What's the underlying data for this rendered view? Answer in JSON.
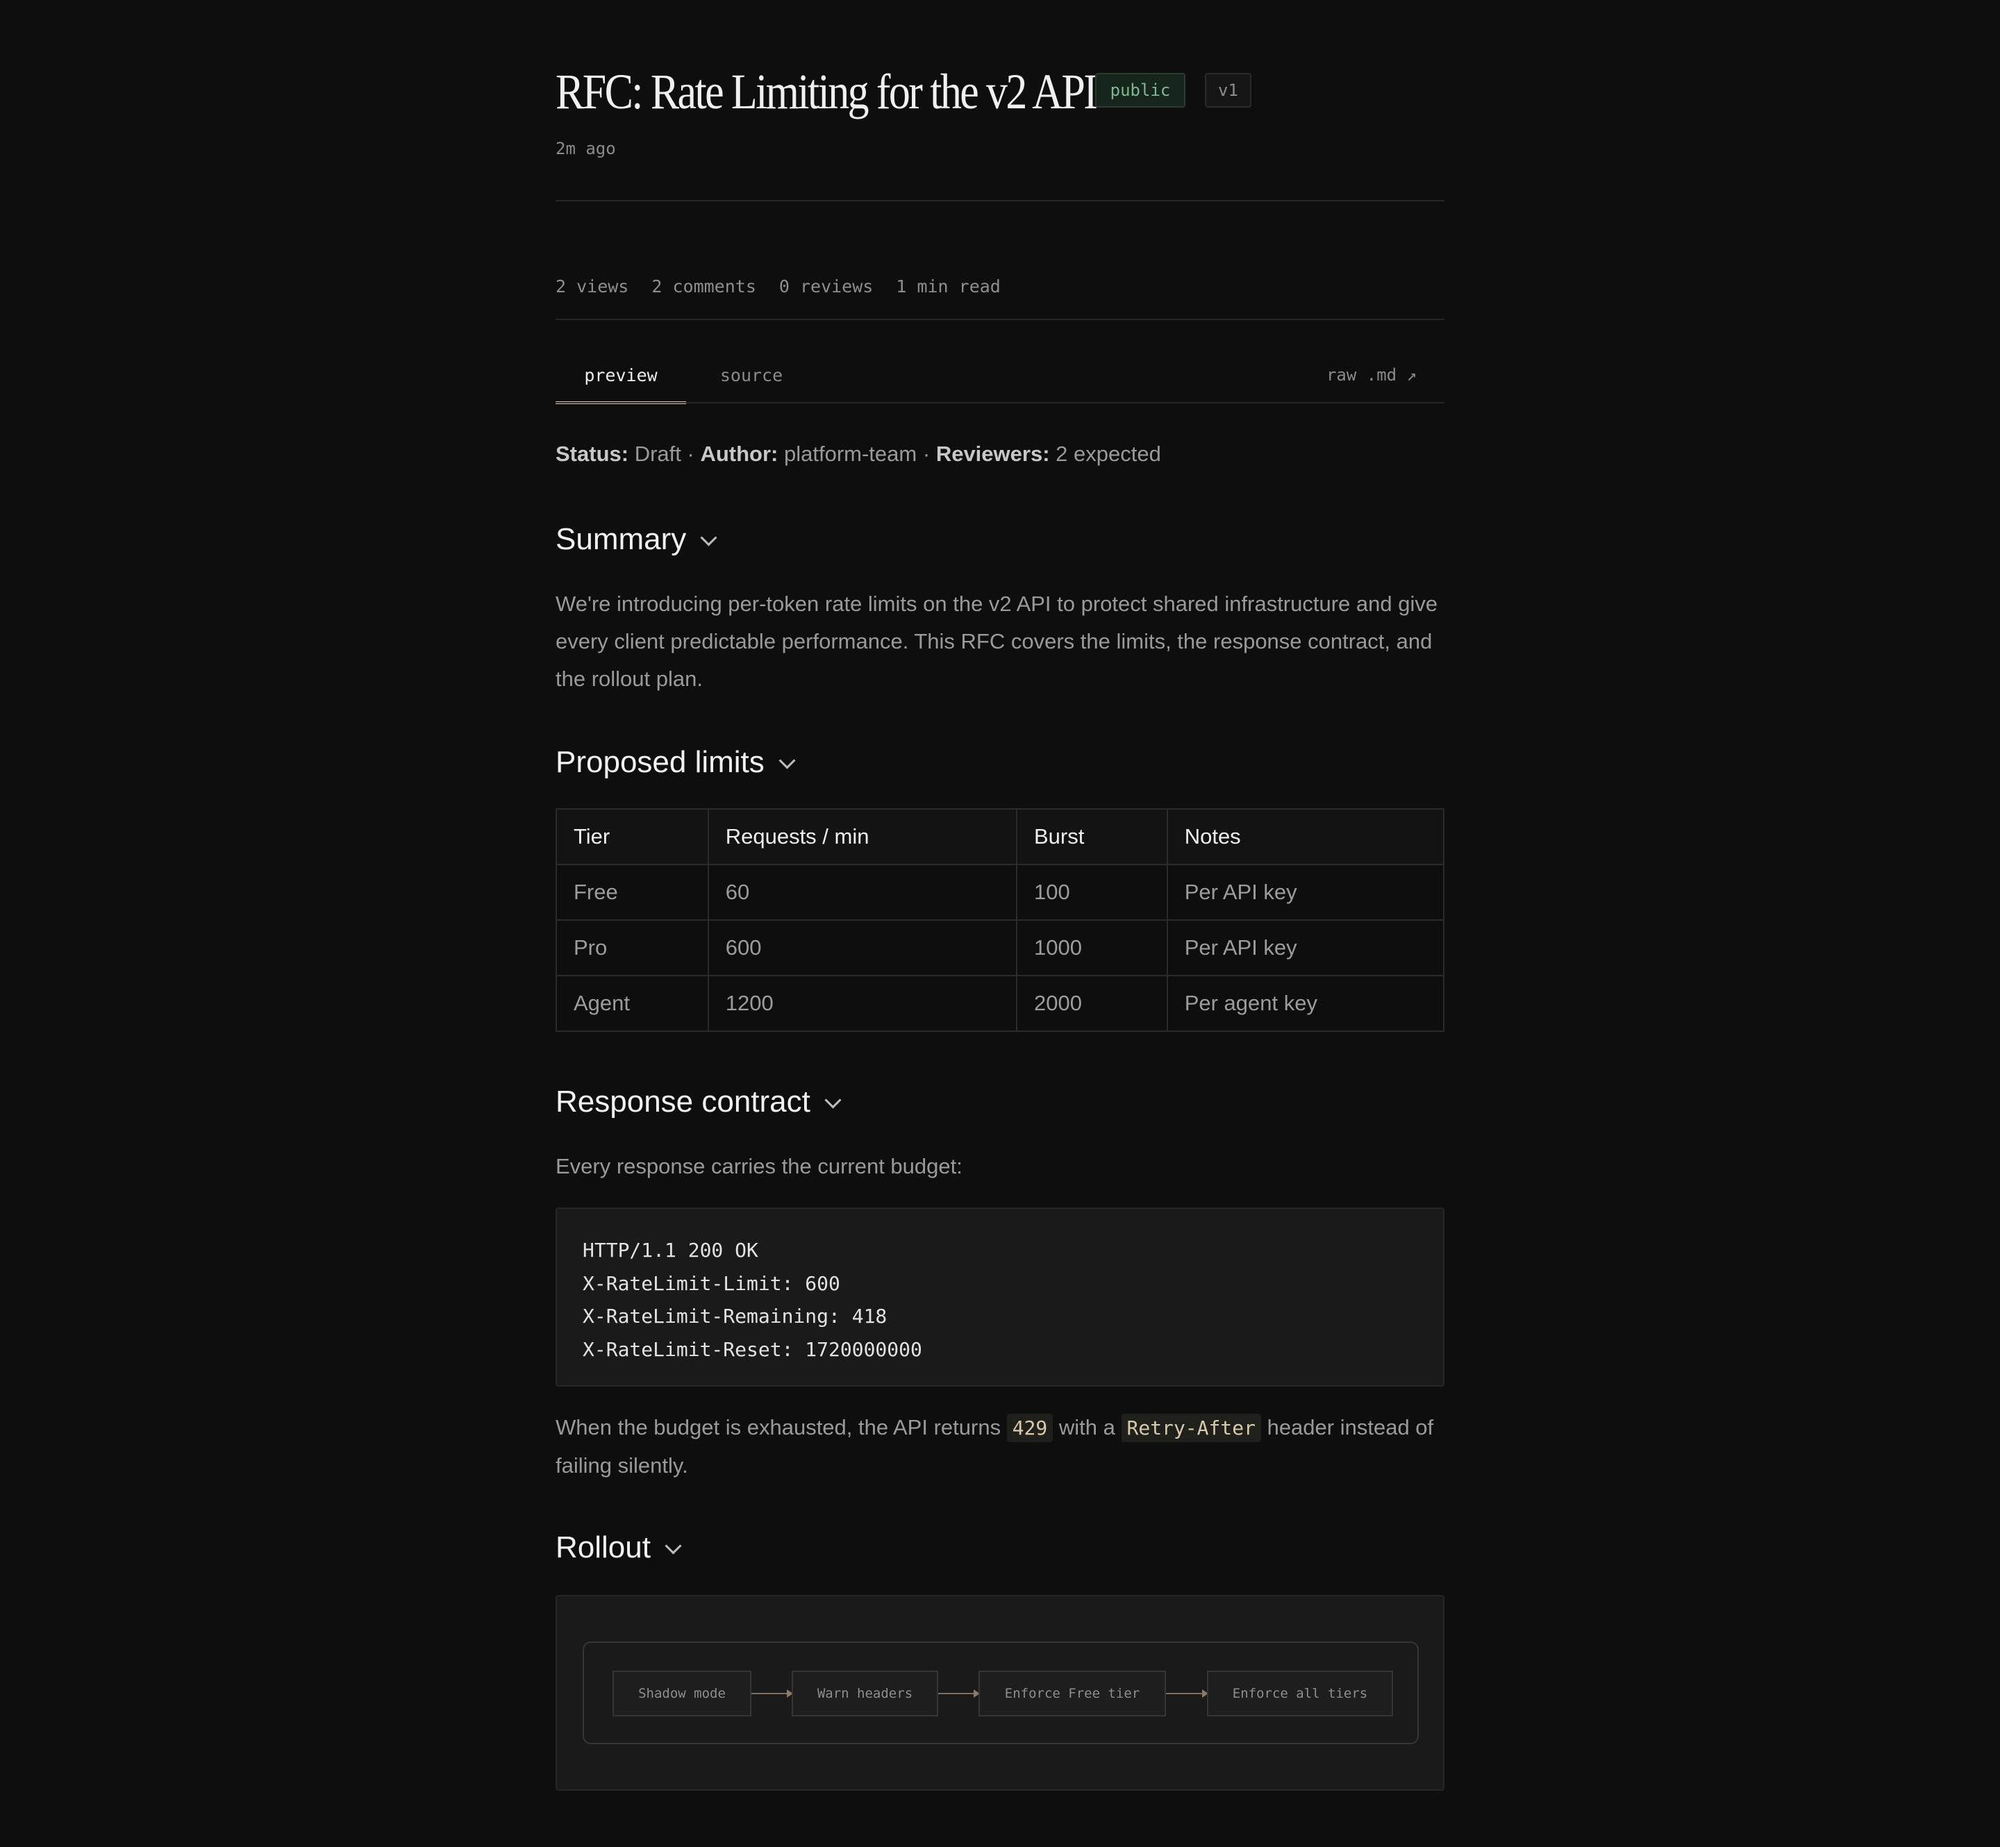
{
  "doc": {
    "title": "RFC: Rate Limiting for the v2 API",
    "badge_visibility": "public",
    "badge_version": "v1",
    "updated": "2m ago"
  },
  "stats": {
    "views": "2 views",
    "comments": "2 comments",
    "reviews": "0 reviews",
    "read_time": "1 min read"
  },
  "tabs": {
    "preview": "preview",
    "source": "source",
    "raw_link": "raw .md ↗"
  },
  "status_line": {
    "status_label": "Status:",
    "status_value": "Draft",
    "author_label": "Author:",
    "author_value": "platform-team",
    "reviewers_label": "Reviewers:",
    "reviewers_value": "2 expected",
    "separator": "·"
  },
  "summary": {
    "heading": "Summary",
    "body": "We're introducing per-token rate limits on the v2 API to protect shared infrastructure and give every client predictable performance. This RFC covers the limits, the response contract, and the rollout plan."
  },
  "limits": {
    "heading": "Proposed limits",
    "columns": [
      "Tier",
      "Requests / min",
      "Burst",
      "Notes"
    ],
    "rows": [
      [
        "Free",
        "60",
        "100",
        "Per API key"
      ],
      [
        "Pro",
        "600",
        "1000",
        "Per API key"
      ],
      [
        "Agent",
        "1200",
        "2000",
        "Per agent key"
      ]
    ]
  },
  "response": {
    "heading": "Response contract",
    "intro": "Every response carries the current budget:",
    "code_lines": [
      "HTTP/1.1 200 OK",
      "X-RateLimit-Limit: 600",
      "X-RateLimit-Remaining: 418",
      "X-RateLimit-Reset: 1720000000"
    ],
    "after_1": "When the budget is exhausted, the API returns",
    "code_status": "429",
    "after_2": "with a",
    "code_header": "Retry-After",
    "after_3": "header instead of failing silently."
  },
  "rollout": {
    "heading": "Rollout",
    "steps": [
      "Shadow mode",
      "Warn headers",
      "Enforce Free tier",
      "Enforce all tiers"
    ]
  }
}
